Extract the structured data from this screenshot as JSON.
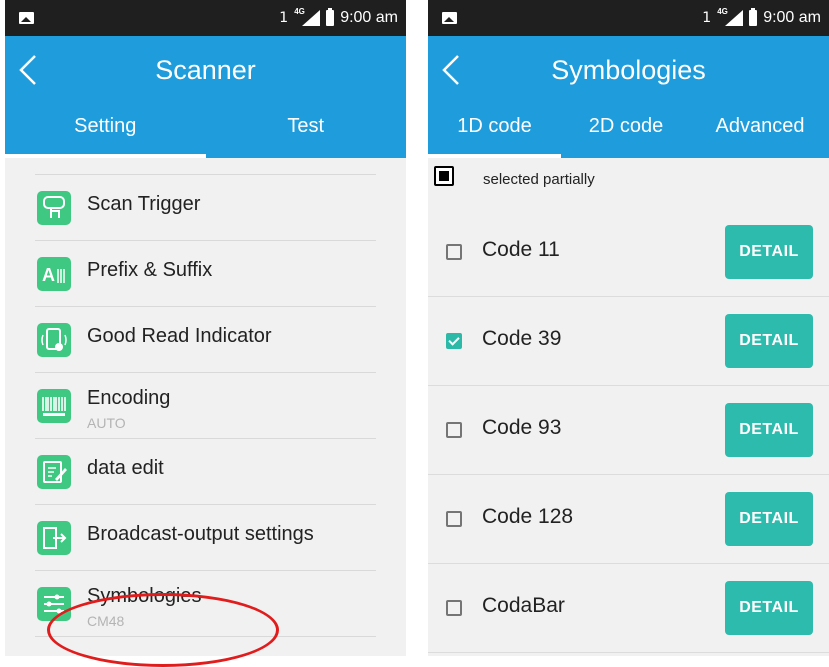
{
  "status": {
    "sim": "1",
    "network": "4G",
    "time": "9:00 am"
  },
  "left_screen": {
    "title": "Scanner",
    "tabs": [
      {
        "label": "Setting",
        "active": true
      },
      {
        "label": "Test",
        "active": false
      }
    ],
    "items": [
      {
        "label": "Scan Trigger",
        "icon": "scan-trigger-icon"
      },
      {
        "label": "Prefix & Suffix",
        "icon": "prefix-suffix-icon"
      },
      {
        "label": "Good Read Indicator",
        "icon": "good-read-indicator-icon"
      },
      {
        "label": "Encoding",
        "sub": "AUTO",
        "icon": "barcode-icon"
      },
      {
        "label": "data edit",
        "icon": "edit-icon"
      },
      {
        "label": "Broadcast-output settings",
        "icon": "broadcast-output-icon"
      },
      {
        "label": "Symbologies",
        "sub": "CM48",
        "icon": "symbologies-icon"
      }
    ]
  },
  "right_screen": {
    "title": "Symbologies",
    "tabs": [
      {
        "label": "1D code",
        "active": true
      },
      {
        "label": "2D code",
        "active": false
      },
      {
        "label": "Advanced",
        "active": false
      }
    ],
    "partial_label": "selected partially",
    "detail_label": "DETAIL",
    "symbologies": [
      {
        "name": "Code 11",
        "checked": false
      },
      {
        "name": "Code 39",
        "checked": true
      },
      {
        "name": "Code 93",
        "checked": false
      },
      {
        "name": "Code 128",
        "checked": false
      },
      {
        "name": "CodaBar",
        "checked": false
      }
    ]
  },
  "colors": {
    "appbar": "#1e9cdc",
    "statusbar": "#1f1f1f",
    "icon_green": "#3ec882",
    "detail_button": "#2dbbae",
    "highlight": "#e01c1c"
  }
}
